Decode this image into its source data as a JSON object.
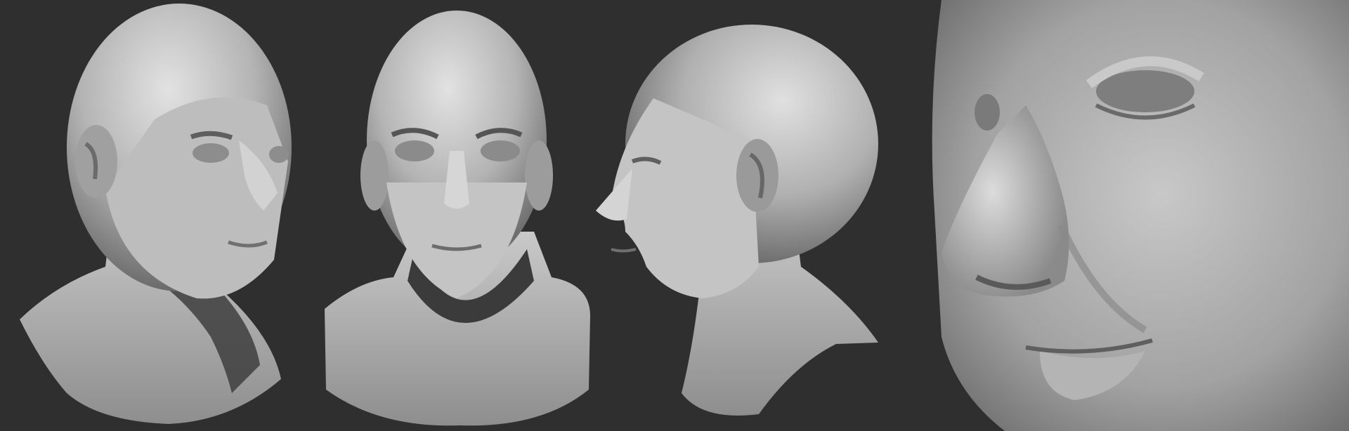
{
  "scene": {
    "background_color": "#2f2f2f",
    "clay_light": "#d8d8d8",
    "clay_mid": "#a9a9a9",
    "clay_dark": "#5a5a5a",
    "views": [
      {
        "view": "three-quarter",
        "icon": "head-sculpt-3q"
      },
      {
        "view": "front",
        "icon": "head-sculpt-front"
      },
      {
        "view": "profile",
        "icon": "head-sculpt-profile"
      },
      {
        "view": "close-up",
        "icon": "face-closeup-nose-eye"
      }
    ]
  }
}
